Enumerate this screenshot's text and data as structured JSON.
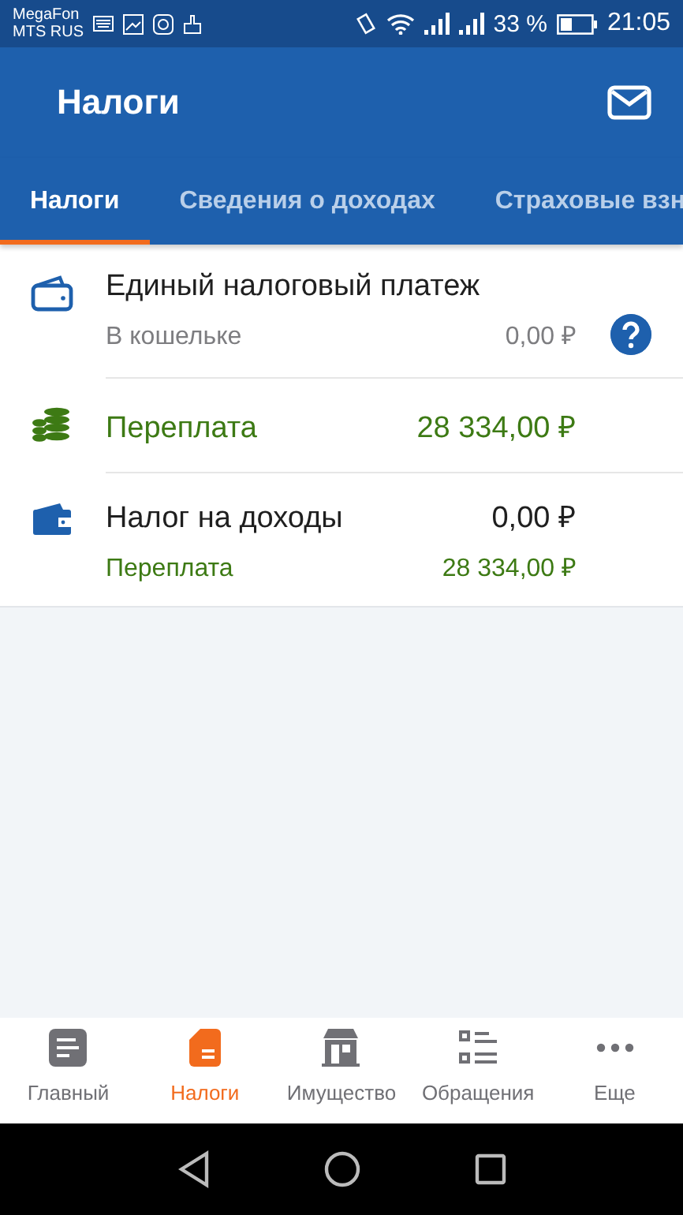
{
  "status_bar": {
    "carriers": [
      "MegaFon",
      "MTS RUS"
    ],
    "battery_percent": "33 %",
    "time": "21:05"
  },
  "header": {
    "title": "Налоги"
  },
  "tabs": [
    {
      "label": "Налоги",
      "selected": true
    },
    {
      "label": "Сведения о доходах",
      "selected": false
    },
    {
      "label": "Страховые взн",
      "selected": false
    }
  ],
  "items": [
    {
      "kind": "wallet",
      "lines": [
        {
          "label": "Единый налоговый платеж"
        },
        {
          "label": "В кошельке",
          "amount": "0,00 ₽"
        }
      ]
    },
    {
      "kind": "overpayment",
      "lines": [
        {
          "label": "Переплата",
          "amount": "28 334,00 ₽"
        }
      ]
    },
    {
      "kind": "tax",
      "lines": [
        {
          "label": "Налог на доходы",
          "amount": "0,00 ₽"
        },
        {
          "label": "Переплата",
          "amount": "28 334,00 ₽"
        }
      ]
    }
  ],
  "bottom_nav": [
    {
      "label": "Главный",
      "selected": false
    },
    {
      "label": "Налоги",
      "selected": true
    },
    {
      "label": "Имущество",
      "selected": false
    },
    {
      "label": "Обращения",
      "selected": false
    },
    {
      "label": "Еще",
      "selected": false
    }
  ]
}
